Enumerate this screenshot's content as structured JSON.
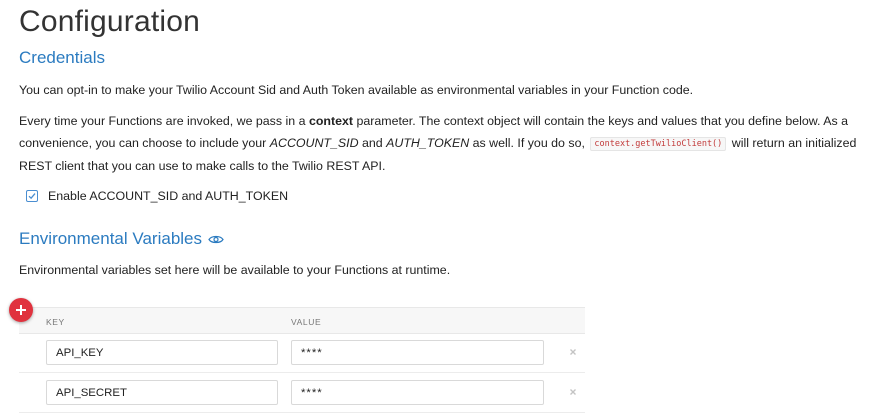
{
  "page": {
    "title": "Configuration"
  },
  "credentials": {
    "title": "Credentials",
    "intro": "You can opt-in to make your Twilio Account Sid and Auth Token available as environmental variables in your Function code.",
    "description": {
      "part1": "Every time your Functions are invoked, we pass in a ",
      "bold": "context",
      "part2": " parameter. The context object will contain the keys and values that you define below. As a convenience, you can choose to include your ",
      "italic1": "ACCOUNT_SID",
      "part3": " and ",
      "italic2": "AUTH_TOKEN",
      "part4": " as well. If you do so, ",
      "code": "context.getTwilioClient()",
      "part5": " will return an initialized REST client that you can use to make calls to the Twilio REST API."
    },
    "checkbox_label": "Enable ACCOUNT_SID and AUTH_TOKEN",
    "checkbox_checked": true
  },
  "env": {
    "title": "Environmental Variables",
    "title_icon": "eye-icon",
    "description": "Environmental variables set here will be available to your Functions at runtime.",
    "add_icon": "plus-icon",
    "columns": {
      "key": "KEY",
      "value": "VALUE"
    },
    "rows": [
      {
        "key": "API_KEY",
        "value": "****"
      },
      {
        "key": "API_SECRET",
        "value": "****"
      }
    ],
    "remove_icon": "close-icon"
  },
  "colors": {
    "accent": "#2b7bc0",
    "add_button": "#e0323e",
    "code_text": "#c23a3a"
  }
}
